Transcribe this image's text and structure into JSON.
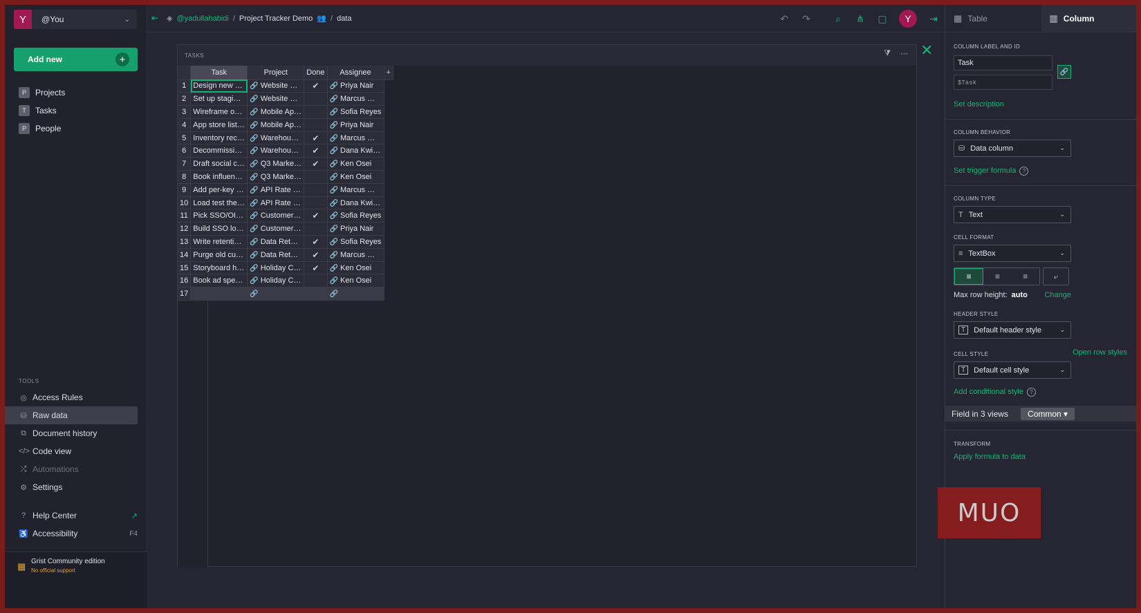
{
  "account": {
    "avatar": "Y",
    "name": "@You"
  },
  "add_new": "Add new",
  "pages": [
    {
      "icon": "P",
      "label": "Projects"
    },
    {
      "icon": "T",
      "label": "Tasks"
    },
    {
      "icon": "P",
      "label": "People"
    }
  ],
  "tools_heading": "TOOLS",
  "tools": [
    {
      "icon": "eye-icon",
      "label": "Access Rules"
    },
    {
      "icon": "database-icon",
      "label": "Raw data"
    },
    {
      "icon": "history-icon",
      "label": "Document history"
    },
    {
      "icon": "code-icon",
      "label": "Code view"
    },
    {
      "icon": "automation-icon",
      "label": "Automations"
    },
    {
      "icon": "gear-icon",
      "label": "Settings"
    }
  ],
  "help": {
    "help_center": "Help Center",
    "accessibility": "Accessibility",
    "accessibility_key": "F4"
  },
  "footer": {
    "title": "Grist Community edition",
    "subtitle": "No official support"
  },
  "breadcrumb": {
    "org": "@yadullahabidi",
    "doc": "Project Tracker Demo",
    "page": "data"
  },
  "topbar_avatar": "Y",
  "section": {
    "title": "TASKS"
  },
  "table": {
    "columns": [
      "Task",
      "Project",
      "Done",
      "Assignee"
    ],
    "add_column": "+",
    "rows": [
      {
        "n": "1",
        "task": "Design new h…",
        "project": "Website R…",
        "done": true,
        "assignee": "Priya Nair"
      },
      {
        "n": "2",
        "task": "Set up stagin…",
        "project": "Website R…",
        "done": false,
        "assignee": "Marcus W…"
      },
      {
        "n": "3",
        "task": "Wireframe on…",
        "project": "Mobile Ap…",
        "done": false,
        "assignee": "Sofia Reyes"
      },
      {
        "n": "4",
        "task": "App store listi…",
        "project": "Mobile Ap…",
        "done": false,
        "assignee": "Priya Nair"
      },
      {
        "n": "5",
        "task": "Inventory rec…",
        "project": "Warehous…",
        "done": true,
        "assignee": "Marcus W…"
      },
      {
        "n": "6",
        "task": "Decommissio…",
        "project": "Warehous…",
        "done": true,
        "assignee": "Dana Kwi…"
      },
      {
        "n": "7",
        "task": "Draft social c…",
        "project": "Q3 Market…",
        "done": true,
        "assignee": "Ken Osei"
      },
      {
        "n": "8",
        "task": "Book influenc…",
        "project": "Q3 Market…",
        "done": false,
        "assignee": "Ken Osei"
      },
      {
        "n": "9",
        "task": "Add per-key r…",
        "project": "API Rate …",
        "done": false,
        "assignee": "Marcus W…"
      },
      {
        "n": "10",
        "task": "Load test the …",
        "project": "API Rate …",
        "done": false,
        "assignee": "Dana Kwi…"
      },
      {
        "n": "11",
        "task": "Pick SSO/OI…",
        "project": "Customer …",
        "done": true,
        "assignee": "Sofia Reyes"
      },
      {
        "n": "12",
        "task": "Build SSO lo…",
        "project": "Customer …",
        "done": false,
        "assignee": "Priya Nair"
      },
      {
        "n": "13",
        "task": "Write retentio…",
        "project": "Data Rete…",
        "done": true,
        "assignee": "Sofia Reyes"
      },
      {
        "n": "14",
        "task": "Purge old cus…",
        "project": "Data Rete…",
        "done": true,
        "assignee": "Marcus W…"
      },
      {
        "n": "15",
        "task": "Storyboard h…",
        "project": "Holiday C…",
        "done": true,
        "assignee": "Ken Osei"
      },
      {
        "n": "16",
        "task": "Book ad spen…",
        "project": "Holiday C…",
        "done": false,
        "assignee": "Ken Osei"
      }
    ],
    "new_row_number": "17"
  },
  "panel": {
    "tab_table": "Table",
    "tab_column": "Column",
    "label_heading": "COLUMN LABEL AND ID",
    "label_value": "Task",
    "id_value": "$Task",
    "set_description": "Set description",
    "behavior_heading": "COLUMN BEHAVIOR",
    "behavior_value": "Data column",
    "set_trigger": "Set trigger formula",
    "type_heading": "COLUMN TYPE",
    "type_value": "Text",
    "format_heading": "CELL FORMAT",
    "format_value": "TextBox",
    "max_row_label": "Max row height:",
    "max_row_value": "auto",
    "change": "Change",
    "header_style_heading": "HEADER STYLE",
    "header_style_value": "Default header style",
    "cell_style_heading": "CELL STYLE",
    "open_row_styles": "Open row styles",
    "cell_style_value": "Default cell style",
    "add_conditional": "Add conditional style",
    "field_views": "Field in 3 views",
    "common": "Common",
    "transform_heading": "TRANSFORM",
    "apply_formula": "Apply formula to data"
  },
  "watermark": "MUO",
  "colors": {
    "accent": "#16b378",
    "avatar": "#a01a4f",
    "background": "#262633"
  }
}
